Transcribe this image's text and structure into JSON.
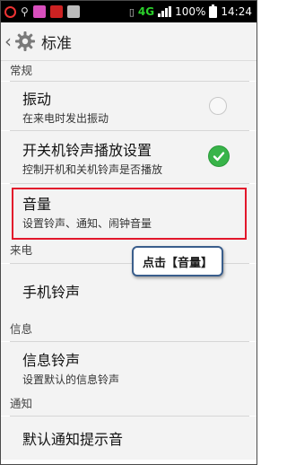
{
  "status_bar": {
    "network": "4G",
    "battery_percent": "100%",
    "time": "14:24"
  },
  "header": {
    "back_icon": "chevron-left-icon",
    "settings_icon": "gear-icon",
    "title": "标准"
  },
  "sections": {
    "general": "常规",
    "incoming": "来电",
    "message": "信息",
    "notification": "通知"
  },
  "items": {
    "vibrate": {
      "title": "振动",
      "subtitle": "在来电时发出振动",
      "checked": false
    },
    "boot_ringtone": {
      "title": "开关机铃声播放设置",
      "subtitle": "控制开机和关机铃声是否播放",
      "checked": true
    },
    "volume": {
      "title": "音量",
      "subtitle": "设置铃声、通知、闹钟音量"
    },
    "phone_ringtone": {
      "title": "手机铃声"
    },
    "message_ringtone": {
      "title": "信息铃声",
      "subtitle": "设置默认的信息铃声"
    },
    "default_notification": {
      "title": "默认通知提示音"
    }
  },
  "annotation": {
    "callout_text": "点击【音量】",
    "highlight_color": "#e2172b",
    "callout_border_color": "#3a5e8c"
  },
  "colors": {
    "check_on": "#38b449",
    "background": "#f3f3f3"
  }
}
